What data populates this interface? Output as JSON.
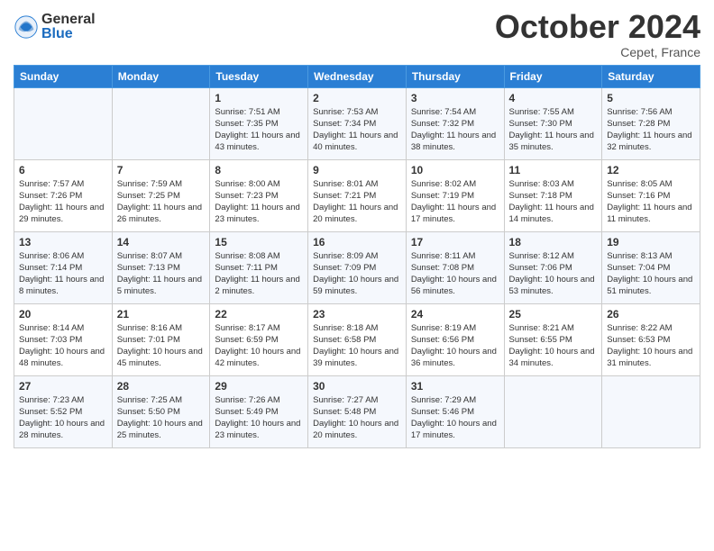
{
  "logo": {
    "general": "General",
    "blue": "Blue"
  },
  "title": "October 2024",
  "location": "Cepet, France",
  "days_of_week": [
    "Sunday",
    "Monday",
    "Tuesday",
    "Wednesday",
    "Thursday",
    "Friday",
    "Saturday"
  ],
  "weeks": [
    [
      {
        "day": "",
        "sunrise": "",
        "sunset": "",
        "daylight": ""
      },
      {
        "day": "",
        "sunrise": "",
        "sunset": "",
        "daylight": ""
      },
      {
        "day": "1",
        "sunrise": "Sunrise: 7:51 AM",
        "sunset": "Sunset: 7:35 PM",
        "daylight": "Daylight: 11 hours and 43 minutes."
      },
      {
        "day": "2",
        "sunrise": "Sunrise: 7:53 AM",
        "sunset": "Sunset: 7:34 PM",
        "daylight": "Daylight: 11 hours and 40 minutes."
      },
      {
        "day": "3",
        "sunrise": "Sunrise: 7:54 AM",
        "sunset": "Sunset: 7:32 PM",
        "daylight": "Daylight: 11 hours and 38 minutes."
      },
      {
        "day": "4",
        "sunrise": "Sunrise: 7:55 AM",
        "sunset": "Sunset: 7:30 PM",
        "daylight": "Daylight: 11 hours and 35 minutes."
      },
      {
        "day": "5",
        "sunrise": "Sunrise: 7:56 AM",
        "sunset": "Sunset: 7:28 PM",
        "daylight": "Daylight: 11 hours and 32 minutes."
      }
    ],
    [
      {
        "day": "6",
        "sunrise": "Sunrise: 7:57 AM",
        "sunset": "Sunset: 7:26 PM",
        "daylight": "Daylight: 11 hours and 29 minutes."
      },
      {
        "day": "7",
        "sunrise": "Sunrise: 7:59 AM",
        "sunset": "Sunset: 7:25 PM",
        "daylight": "Daylight: 11 hours and 26 minutes."
      },
      {
        "day": "8",
        "sunrise": "Sunrise: 8:00 AM",
        "sunset": "Sunset: 7:23 PM",
        "daylight": "Daylight: 11 hours and 23 minutes."
      },
      {
        "day": "9",
        "sunrise": "Sunrise: 8:01 AM",
        "sunset": "Sunset: 7:21 PM",
        "daylight": "Daylight: 11 hours and 20 minutes."
      },
      {
        "day": "10",
        "sunrise": "Sunrise: 8:02 AM",
        "sunset": "Sunset: 7:19 PM",
        "daylight": "Daylight: 11 hours and 17 minutes."
      },
      {
        "day": "11",
        "sunrise": "Sunrise: 8:03 AM",
        "sunset": "Sunset: 7:18 PM",
        "daylight": "Daylight: 11 hours and 14 minutes."
      },
      {
        "day": "12",
        "sunrise": "Sunrise: 8:05 AM",
        "sunset": "Sunset: 7:16 PM",
        "daylight": "Daylight: 11 hours and 11 minutes."
      }
    ],
    [
      {
        "day": "13",
        "sunrise": "Sunrise: 8:06 AM",
        "sunset": "Sunset: 7:14 PM",
        "daylight": "Daylight: 11 hours and 8 minutes."
      },
      {
        "day": "14",
        "sunrise": "Sunrise: 8:07 AM",
        "sunset": "Sunset: 7:13 PM",
        "daylight": "Daylight: 11 hours and 5 minutes."
      },
      {
        "day": "15",
        "sunrise": "Sunrise: 8:08 AM",
        "sunset": "Sunset: 7:11 PM",
        "daylight": "Daylight: 11 hours and 2 minutes."
      },
      {
        "day": "16",
        "sunrise": "Sunrise: 8:09 AM",
        "sunset": "Sunset: 7:09 PM",
        "daylight": "Daylight: 10 hours and 59 minutes."
      },
      {
        "day": "17",
        "sunrise": "Sunrise: 8:11 AM",
        "sunset": "Sunset: 7:08 PM",
        "daylight": "Daylight: 10 hours and 56 minutes."
      },
      {
        "day": "18",
        "sunrise": "Sunrise: 8:12 AM",
        "sunset": "Sunset: 7:06 PM",
        "daylight": "Daylight: 10 hours and 53 minutes."
      },
      {
        "day": "19",
        "sunrise": "Sunrise: 8:13 AM",
        "sunset": "Sunset: 7:04 PM",
        "daylight": "Daylight: 10 hours and 51 minutes."
      }
    ],
    [
      {
        "day": "20",
        "sunrise": "Sunrise: 8:14 AM",
        "sunset": "Sunset: 7:03 PM",
        "daylight": "Daylight: 10 hours and 48 minutes."
      },
      {
        "day": "21",
        "sunrise": "Sunrise: 8:16 AM",
        "sunset": "Sunset: 7:01 PM",
        "daylight": "Daylight: 10 hours and 45 minutes."
      },
      {
        "day": "22",
        "sunrise": "Sunrise: 8:17 AM",
        "sunset": "Sunset: 6:59 PM",
        "daylight": "Daylight: 10 hours and 42 minutes."
      },
      {
        "day": "23",
        "sunrise": "Sunrise: 8:18 AM",
        "sunset": "Sunset: 6:58 PM",
        "daylight": "Daylight: 10 hours and 39 minutes."
      },
      {
        "day": "24",
        "sunrise": "Sunrise: 8:19 AM",
        "sunset": "Sunset: 6:56 PM",
        "daylight": "Daylight: 10 hours and 36 minutes."
      },
      {
        "day": "25",
        "sunrise": "Sunrise: 8:21 AM",
        "sunset": "Sunset: 6:55 PM",
        "daylight": "Daylight: 10 hours and 34 minutes."
      },
      {
        "day": "26",
        "sunrise": "Sunrise: 8:22 AM",
        "sunset": "Sunset: 6:53 PM",
        "daylight": "Daylight: 10 hours and 31 minutes."
      }
    ],
    [
      {
        "day": "27",
        "sunrise": "Sunrise: 7:23 AM",
        "sunset": "Sunset: 5:52 PM",
        "daylight": "Daylight: 10 hours and 28 minutes."
      },
      {
        "day": "28",
        "sunrise": "Sunrise: 7:25 AM",
        "sunset": "Sunset: 5:50 PM",
        "daylight": "Daylight: 10 hours and 25 minutes."
      },
      {
        "day": "29",
        "sunrise": "Sunrise: 7:26 AM",
        "sunset": "Sunset: 5:49 PM",
        "daylight": "Daylight: 10 hours and 23 minutes."
      },
      {
        "day": "30",
        "sunrise": "Sunrise: 7:27 AM",
        "sunset": "Sunset: 5:48 PM",
        "daylight": "Daylight: 10 hours and 20 minutes."
      },
      {
        "day": "31",
        "sunrise": "Sunrise: 7:29 AM",
        "sunset": "Sunset: 5:46 PM",
        "daylight": "Daylight: 10 hours and 17 minutes."
      },
      {
        "day": "",
        "sunrise": "",
        "sunset": "",
        "daylight": ""
      },
      {
        "day": "",
        "sunrise": "",
        "sunset": "",
        "daylight": ""
      }
    ]
  ]
}
